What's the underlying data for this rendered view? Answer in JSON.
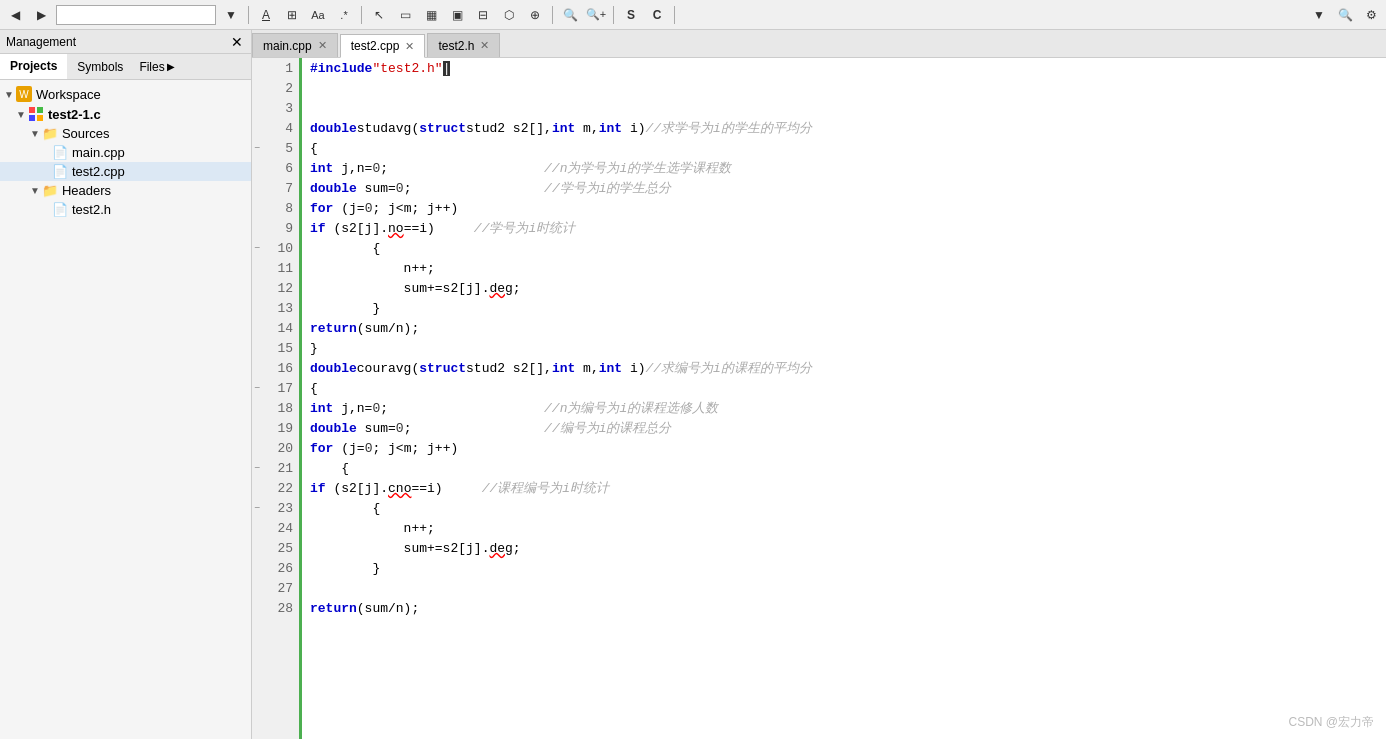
{
  "toolbar": {
    "nav_back": "◀",
    "nav_forward": "▶",
    "search_input_value": "",
    "highlight_btn": "A̲",
    "bookmark_btn": "⊞",
    "match_case_btn": "Aa",
    "regex_btn": ".*",
    "cursor_btn": "↖",
    "rect_btn": "□",
    "img_btn": "▦",
    "film_btn": "▣",
    "snap_btn": "⊟",
    "hex_btn": "⬡",
    "move_btn": "⊕",
    "search_icon": "🔍",
    "zoom_in": "+",
    "zoom_out": "-",
    "S_btn": "S",
    "C_btn": "C",
    "dropdown_arrow": "▼",
    "search2_icon": "🔍",
    "settings_icon": "⚙"
  },
  "management": {
    "title": "Management",
    "close_label": "✕",
    "tabs": {
      "projects": "Projects",
      "symbols": "Symbols",
      "files": "Files",
      "files_arrow": "▶"
    }
  },
  "tree": {
    "workspace_label": "Workspace",
    "project_label": "test2-1.c",
    "sources_label": "Sources",
    "main_cpp_label": "main.cpp",
    "test2_cpp_label": "test2.cpp",
    "headers_label": "Headers",
    "test2_h_label": "test2.h"
  },
  "editor": {
    "tabs": [
      {
        "label": "main.cpp",
        "active": false,
        "closeable": true
      },
      {
        "label": "test2.cpp",
        "active": true,
        "closeable": true
      },
      {
        "label": "test2.h",
        "active": false,
        "closeable": true
      }
    ]
  },
  "code": {
    "lines": [
      {
        "num": 1,
        "content": "#include \"test2.h\"",
        "type": "include"
      },
      {
        "num": 2,
        "content": "",
        "type": "blank"
      },
      {
        "num": 3,
        "content": "",
        "type": "blank"
      },
      {
        "num": 4,
        "content": "double studavg(struct stud2 s2[],int m,int i)    //求学号为i的学生的平均分",
        "type": "func"
      },
      {
        "num": 5,
        "content": "{",
        "type": "brace",
        "collapse": true
      },
      {
        "num": 6,
        "content": "    int j,n=0;                    //n为学号为i的学生选学课程数",
        "type": "code"
      },
      {
        "num": 7,
        "content": "    double sum=0;                 //学号为i的学生总分",
        "type": "code"
      },
      {
        "num": 8,
        "content": "    for (j=0; j<m; j++)",
        "type": "code"
      },
      {
        "num": 9,
        "content": "        if (s2[j].no==i)     //学号为i时统计",
        "type": "code"
      },
      {
        "num": 10,
        "content": "        {",
        "type": "brace",
        "collapse": true
      },
      {
        "num": 11,
        "content": "            n++;",
        "type": "code"
      },
      {
        "num": 12,
        "content": "            sum+=s2[j].deg;",
        "type": "code"
      },
      {
        "num": 13,
        "content": "        }",
        "type": "code"
      },
      {
        "num": 14,
        "content": "    return(sum/n);",
        "type": "code"
      },
      {
        "num": 15,
        "content": "}",
        "type": "brace",
        "breakpoint": true
      },
      {
        "num": 16,
        "content": "double couravg(struct stud2 s2[],int m,int i)    //求编号为i的课程的平均分",
        "type": "func"
      },
      {
        "num": 17,
        "content": "{",
        "type": "brace",
        "collapse": true
      },
      {
        "num": 18,
        "content": "    int j,n=0;                    //n为编号为i的课程选修人数",
        "type": "code"
      },
      {
        "num": 19,
        "content": "    double sum=0;                 //编号为i的课程总分",
        "type": "code"
      },
      {
        "num": 20,
        "content": "    for (j=0; j<m; j++)",
        "type": "code"
      },
      {
        "num": 21,
        "content": "    {",
        "type": "brace",
        "collapse": true
      },
      {
        "num": 22,
        "content": "        if (s2[j].cno==i)     //课程编号为i时统计",
        "type": "code"
      },
      {
        "num": 23,
        "content": "        {",
        "type": "brace",
        "collapse": true
      },
      {
        "num": 24,
        "content": "            n++;",
        "type": "code"
      },
      {
        "num": 25,
        "content": "            sum+=s2[j].deg;",
        "type": "code"
      },
      {
        "num": 26,
        "content": "        }",
        "type": "code"
      },
      {
        "num": 27,
        "content": "",
        "type": "blank"
      },
      {
        "num": 28,
        "content": "    return(sum/n);",
        "type": "code"
      }
    ]
  },
  "watermark": "CSDN @宏力帝"
}
